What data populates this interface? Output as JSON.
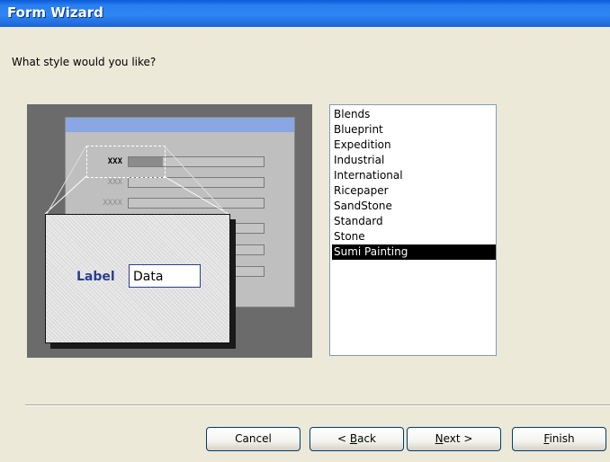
{
  "window": {
    "title": "Form Wizard"
  },
  "prompt": "What style would you like?",
  "preview": {
    "row_labels": [
      "XXX",
      "XXX",
      "XXXX",
      "",
      "",
      ""
    ],
    "sample_label": "Label",
    "sample_data": "Data"
  },
  "styles": {
    "items": [
      "Blends",
      "Blueprint",
      "Expedition",
      "Industrial",
      "International",
      "Ricepaper",
      "SandStone",
      "Standard",
      "Stone",
      "Sumi Painting"
    ],
    "selected": "Sumi Painting"
  },
  "buttons": {
    "cancel": "Cancel",
    "back_prefix": "< ",
    "back_key": "B",
    "back_rest": "ack",
    "next_key": "N",
    "next_rest": "ext >",
    "finish_key": "F",
    "finish_rest": "inish"
  }
}
